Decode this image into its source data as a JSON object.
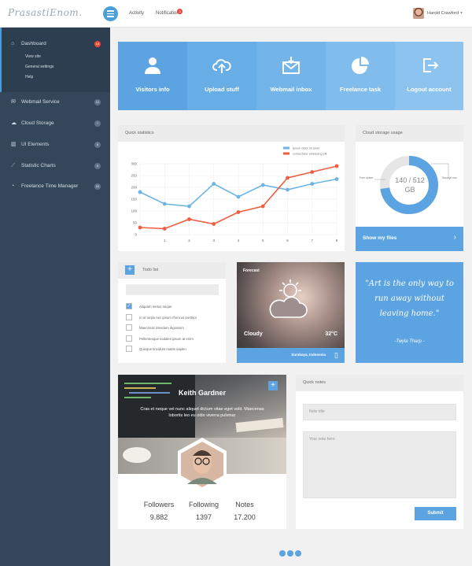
{
  "topbar": {
    "logo": "PrasastiEnom.",
    "nav": {
      "activity": "Activity",
      "notifications": "Notifications",
      "notifications_count": "3"
    },
    "user": {
      "name": "Harold Crawford"
    }
  },
  "sidebar": {
    "items": [
      {
        "label": "Dashboard",
        "badge": "14",
        "icon": "home-icon"
      },
      {
        "label": "Webmail Service",
        "badge": "12",
        "icon": "mail-icon"
      },
      {
        "label": "Cloud Storage",
        "badge": "7",
        "icon": "cloud-icon"
      },
      {
        "label": "UI Elements",
        "badge": "8",
        "icon": "grid-icon"
      },
      {
        "label": "Statistic Charts",
        "badge": "6",
        "icon": "chart-icon"
      },
      {
        "label": "Freelance Time Manager",
        "badge": "24",
        "icon": "pie-icon"
      }
    ],
    "submenu": [
      "View site",
      "General settings",
      "Help"
    ]
  },
  "tiles": [
    {
      "label": "Visitors info",
      "icon": "user-icon",
      "color": "#5ba3e1"
    },
    {
      "label": "Upload stuff",
      "icon": "upload-cloud-icon",
      "color": "#67adE6"
    },
    {
      "label": "Webmail inbox",
      "icon": "envelope-icon",
      "color": "#73b4e9"
    },
    {
      "label": "Freelance task",
      "icon": "pie-chart-icon",
      "color": "#80bcec"
    },
    {
      "label": "Logout account",
      "icon": "logout-icon",
      "color": "#8cc3ef"
    }
  ],
  "stats_card": {
    "title": "Quick statistics"
  },
  "chart_data": {
    "type": "line",
    "x": [
      0,
      1,
      2,
      3,
      4,
      5,
      6,
      7,
      8
    ],
    "xticks": [
      "1",
      "2",
      "3",
      "4",
      "5",
      "6",
      "7",
      "8"
    ],
    "yticks": [
      "0",
      "50",
      "100",
      "150",
      "200",
      "250",
      "300"
    ],
    "ylim": [
      0,
      300
    ],
    "grid": true,
    "legend": "top-right",
    "series": [
      {
        "name": "Ipsum dolor sit amet",
        "color": "#6eb5e4",
        "values": [
          180,
          130,
          120,
          215,
          160,
          210,
          190,
          215,
          235
        ]
      },
      {
        "name": "consectetur adipiscing elit",
        "color": "#f05e3f",
        "values": [
          30,
          25,
          65,
          45,
          95,
          120,
          240,
          265,
          290
        ]
      }
    ]
  },
  "storage": {
    "title": "Cloud storage usage",
    "used": "140 / 512",
    "unit": "GB",
    "free_label": "Free space",
    "used_label": "Storage use",
    "used_fraction": 0.273,
    "link": "Show my files"
  },
  "todo": {
    "title": "Todo list",
    "items": [
      {
        "text": "Aliquam metus neque",
        "checked": true
      },
      {
        "text": "In ut turpis nec ipsum rhoncus porttitor",
        "checked": false
      },
      {
        "text": "Maecenas interdum dignissim",
        "checked": false
      },
      {
        "text": "Pellentesque sodales ipsum at enim",
        "checked": false
      },
      {
        "text": "Quisque tincidunt mattis sapien",
        "checked": false
      }
    ]
  },
  "weather": {
    "title": "Forecast",
    "condition": "Cloudy",
    "temp": "32°C",
    "location": "Surabaya, Indonesia"
  },
  "quote": {
    "text": "\"Art is the only way to run away without leaving home.\"",
    "author": "-Twyla Tharp -"
  },
  "profile": {
    "name": "Keith Gardner",
    "bio": "Cras et neque vel nunc aliquet dictum vitae eget velit. Maecenas lobortis leo eu odio viverra pulvinar",
    "stats": [
      {
        "label": "Followers",
        "value": "9.882"
      },
      {
        "label": "Following",
        "value": "1397"
      },
      {
        "label": "Notes",
        "value": "17.200"
      }
    ]
  },
  "notes": {
    "title": "Quick notes",
    "title_placeholder": "Note title",
    "body_placeholder": "Your note here",
    "submit": "Submit"
  }
}
